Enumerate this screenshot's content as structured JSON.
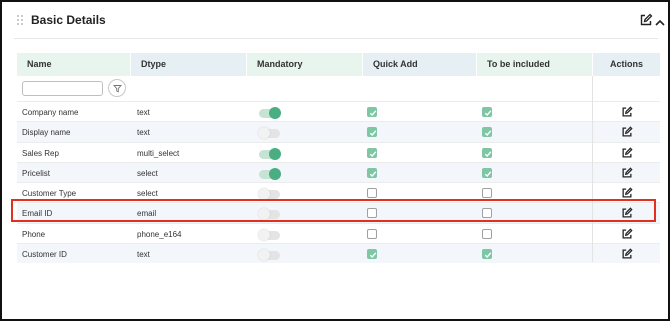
{
  "section": {
    "title": "Basic Details"
  },
  "columns": {
    "name": "Name",
    "dtype": "Dtype",
    "mandatory": "Mandatory",
    "quick_add": "Quick Add",
    "to_be_included": "To be included",
    "actions": "Actions"
  },
  "filter": {
    "placeholder": ""
  },
  "rows": [
    {
      "name": "Company name",
      "dtype": "text",
      "mandatory": true,
      "quick_add": true,
      "to_be_included": true
    },
    {
      "name": "Display name",
      "dtype": "text",
      "mandatory": false,
      "quick_add": true,
      "to_be_included": true
    },
    {
      "name": "Sales Rep",
      "dtype": "multi_select",
      "mandatory": true,
      "quick_add": true,
      "to_be_included": true
    },
    {
      "name": "Pricelist",
      "dtype": "select",
      "mandatory": true,
      "quick_add": true,
      "to_be_included": true
    },
    {
      "name": "Customer Type",
      "dtype": "select",
      "mandatory": false,
      "quick_add": false,
      "to_be_included": false
    },
    {
      "name": "Email ID",
      "dtype": "email",
      "mandatory": false,
      "quick_add": false,
      "to_be_included": false
    },
    {
      "name": "Phone",
      "dtype": "phone_e164",
      "mandatory": false,
      "quick_add": false,
      "to_be_included": false
    },
    {
      "name": "Customer ID",
      "dtype": "text",
      "mandatory": false,
      "quick_add": true,
      "to_be_included": true
    }
  ],
  "highlighted_row": "Email ID",
  "icons": {
    "drag": "drag-handle-icon",
    "edit": "edit-icon",
    "collapse": "chevron-up-icon",
    "filter": "filter-icon"
  },
  "colors": {
    "accent_green": "#4aae82",
    "check_green": "#7ec6a4",
    "highlight_red": "#e0301e",
    "header_green": "#e8f4ee",
    "header_blue": "#e6eff3"
  }
}
